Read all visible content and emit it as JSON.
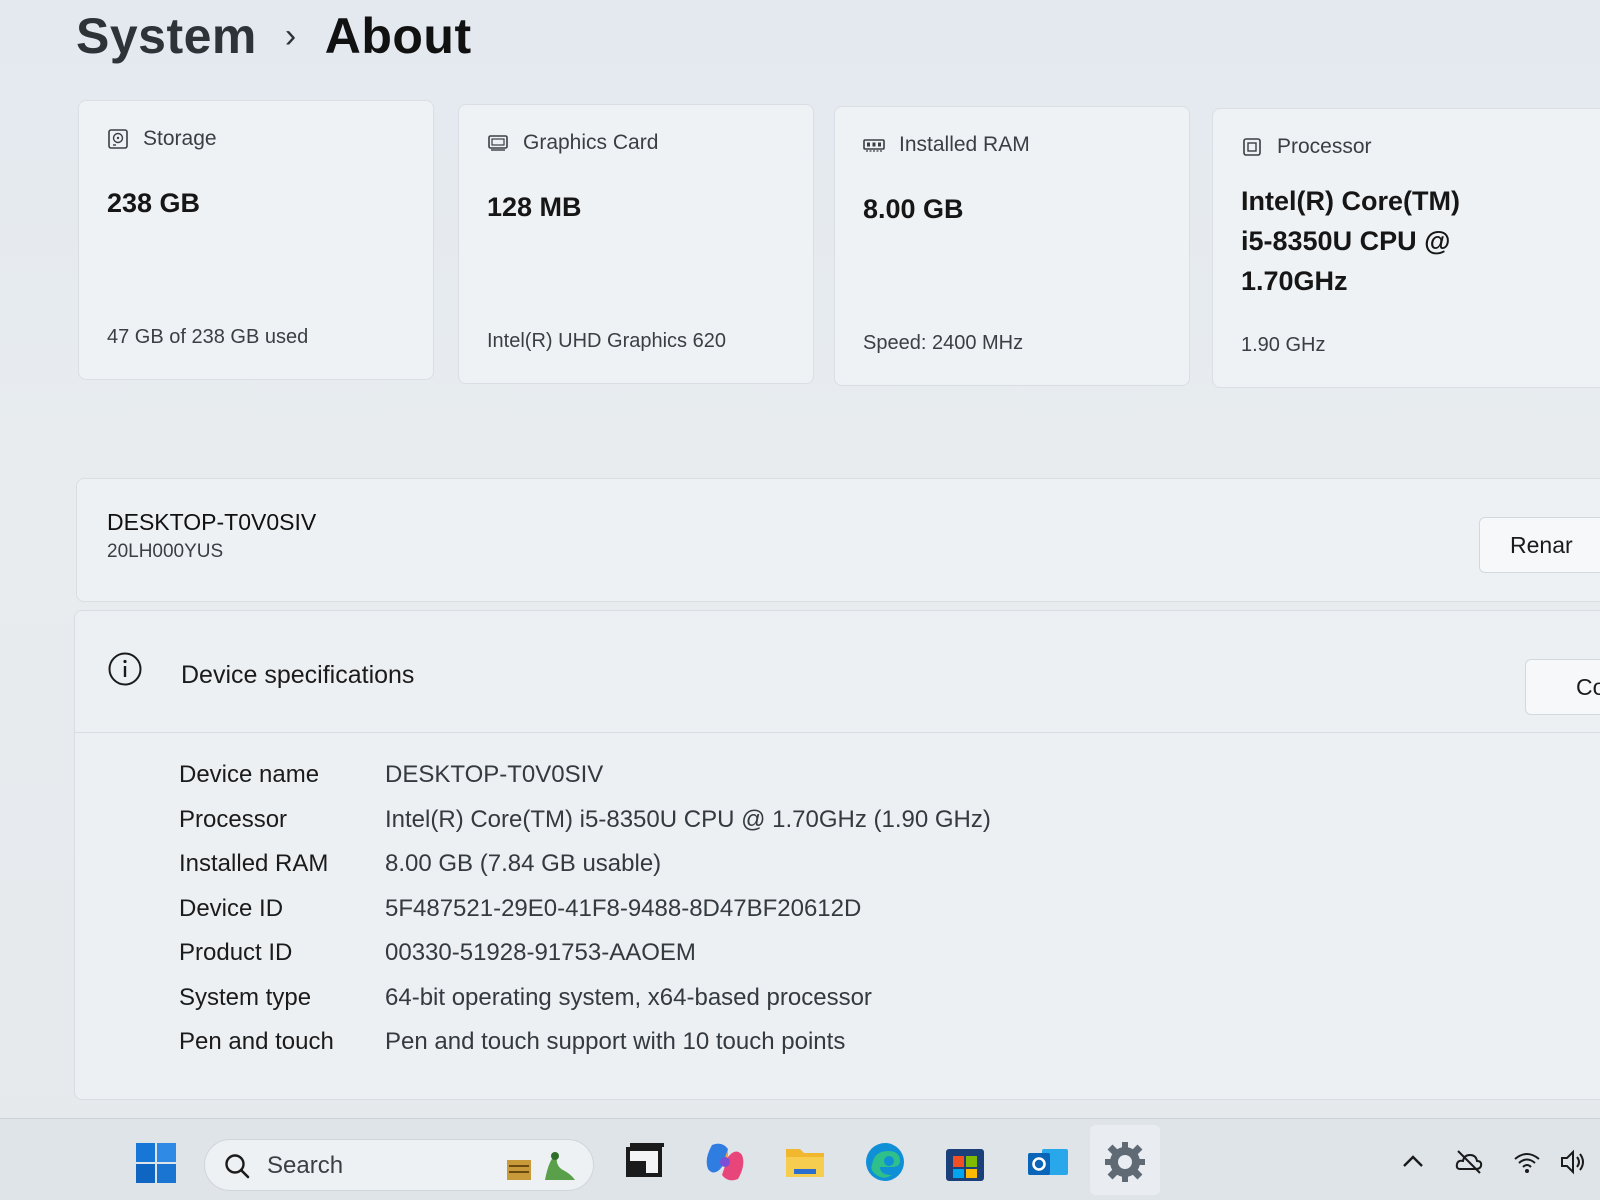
{
  "header": {
    "parent": "System",
    "separator": "›",
    "current": "About"
  },
  "cards": [
    {
      "title": "Storage",
      "value": "238 GB",
      "sub": "47 GB of 238 GB used",
      "icon": "storage-icon"
    },
    {
      "title": "Graphics Card",
      "value": "128 MB",
      "sub": "Intel(R) UHD Graphics 620",
      "icon": "graphics-card-icon"
    },
    {
      "title": "Installed RAM",
      "value": "8.00 GB",
      "sub": "Speed: 2400 MHz",
      "icon": "ram-icon"
    },
    {
      "title": "Processor",
      "value_lines": [
        "Intel(R) Core(TM)",
        "i5-8350U CPU @",
        "1.70GHz"
      ],
      "sub": "1.90 GHz",
      "icon": "processor-icon"
    }
  ],
  "device": {
    "name": "DESKTOP-T0V0SIV",
    "model": "20LH000YUS",
    "rename_label": "Renar"
  },
  "specs": {
    "title": "Device specifications",
    "copy_label": "Co",
    "rows": [
      {
        "label": "Device name",
        "value": "DESKTOP-T0V0SIV"
      },
      {
        "label": "Processor",
        "value": "Intel(R) Core(TM) i5-8350U CPU @ 1.70GHz (1.90 GHz)"
      },
      {
        "label": "Installed RAM",
        "value": "8.00 GB (7.84 GB usable)"
      },
      {
        "label": "Device ID",
        "value": "5F487521-29E0-41F8-9488-8D47BF20612D"
      },
      {
        "label": "Product ID",
        "value": "00330-51928-91753-AAOEM"
      },
      {
        "label": "System type",
        "value": "64-bit operating system, x64-based processor"
      },
      {
        "label": "Pen and touch",
        "value": "Pen and touch support with 10 touch points"
      }
    ]
  },
  "taskbar": {
    "search_label": "Search",
    "apps": [
      "start-icon",
      "search-icon",
      "task-view-icon",
      "copilot-icon",
      "file-explorer-icon",
      "edge-icon",
      "store-icon",
      "outlook-icon",
      "settings-icon"
    ],
    "tray": [
      "chevron-up-icon",
      "onedrive-icon",
      "wifi-icon",
      "volume-icon"
    ],
    "accent": "#0067c0"
  }
}
